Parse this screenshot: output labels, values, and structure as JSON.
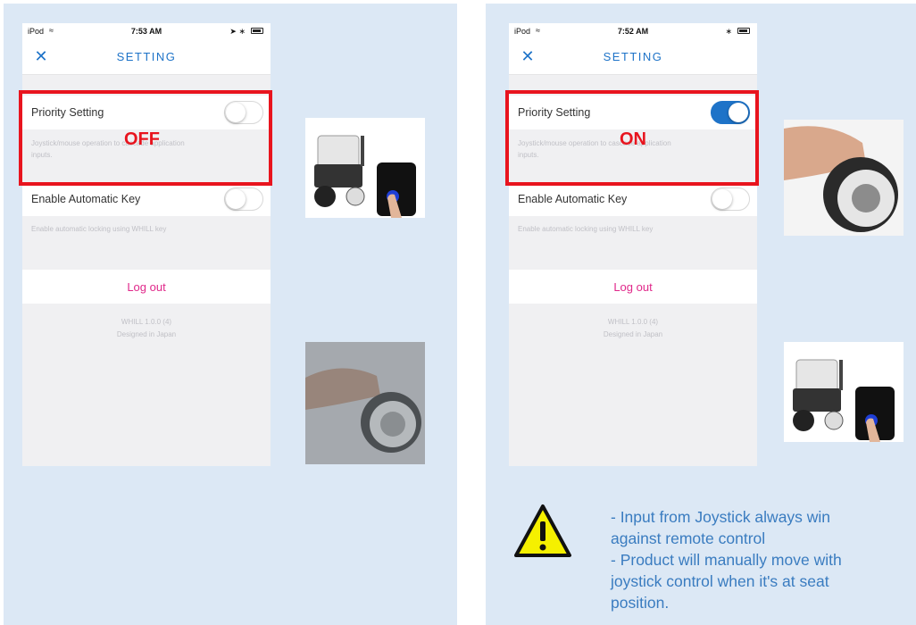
{
  "panels": [
    {
      "status": {
        "carrier": "iPod",
        "time": "7:53 AM"
      },
      "nav": {
        "title": "SETTING"
      },
      "priority": {
        "label": "Priority Setting",
        "desc_line1": "Joystick/mouse operation to cascade application",
        "desc_line2": "inputs.",
        "toggle_on": false
      },
      "auto_key": {
        "label": "Enable Automatic Key",
        "desc": "Enable automatic locking using WHILL key",
        "toggle_on": false
      },
      "logout": "Log out",
      "footer": {
        "version": "WHILL 1.0.0 (4)",
        "designed": "Designed in Japan"
      },
      "state": "OFF"
    },
    {
      "status": {
        "carrier": "iPod",
        "time": "7:52 AM"
      },
      "nav": {
        "title": "SETTING"
      },
      "priority": {
        "label": "Priority Setting",
        "desc_line1": "Joystick/mouse operation to cascade application",
        "desc_line2": "inputs.",
        "toggle_on": true
      },
      "auto_key": {
        "label": "Enable Automatic Key",
        "desc": "Enable automatic locking using WHILL key",
        "toggle_on": false
      },
      "logout": "Log out",
      "footer": {
        "version": "WHILL 1.0.0 (4)",
        "designed": "Designed in Japan"
      },
      "state": "ON"
    }
  ],
  "note": {
    "line1": "- Input from Joystick always win",
    "line2": "against remote control",
    "line3": "- Product will manually move with",
    "line4": "joystick control when it's at seat",
    "line5": "position."
  },
  "icons": {
    "close": "close-icon",
    "wifi": "wifi-icon",
    "battery": "battery-icon",
    "warning": "warning-icon"
  },
  "colors": {
    "accent": "#1e73c8",
    "highlight": "#e8141e",
    "logout": "#e0288a",
    "note": "#3a7cc0",
    "warning_fill": "#f5f000"
  }
}
